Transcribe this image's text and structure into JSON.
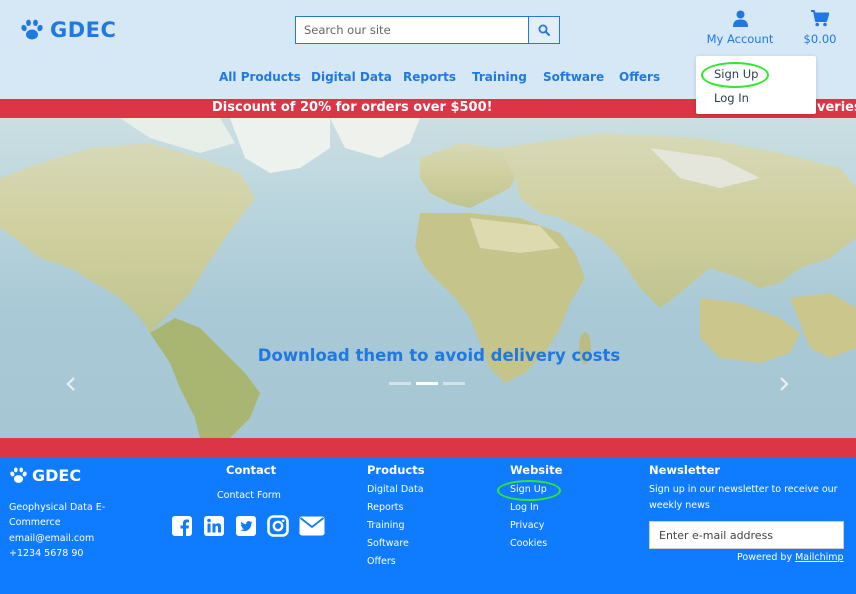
{
  "header": {
    "logo_text": "GDEC",
    "search_placeholder": "Search our site",
    "account_label": "My Account",
    "cart_label": "$0.00"
  },
  "nav": {
    "items": [
      "All Products",
      "Digital Data",
      "Reports",
      "Training",
      "Software",
      "Offers"
    ]
  },
  "account_menu": {
    "items": [
      "Sign Up",
      "Log In"
    ]
  },
  "promo": {
    "text": "Discount of 20% for orders over $500!",
    "text_next": "veries"
  },
  "hero": {
    "caption": "Download them to avoid delivery costs",
    "slide_count": 3,
    "active_slide": 2
  },
  "footer": {
    "logo_text": "GDEC",
    "company_line1": "Geophysical Data E-",
    "company_line2": "Commerce",
    "email": "email@email.com",
    "phone": "+1234 5678 90",
    "contact": {
      "heading": "Contact",
      "link": "Contact Form"
    },
    "products": {
      "heading": "Products",
      "links": [
        "Digital Data",
        "Reports",
        "Training",
        "Software",
        "Offers"
      ]
    },
    "website": {
      "heading": "Website",
      "links": [
        "Sign Up",
        "Log In",
        "Privacy",
        "Cookies"
      ]
    },
    "newsletter": {
      "heading": "Newsletter",
      "text_line1": "Sign up in our newsletter to receive our",
      "text_line2": "weekly news",
      "input_placeholder": "Enter e-mail address",
      "powered_prefix": "Powered by ",
      "powered_link": "Mailchimp"
    },
    "socials": [
      "facebook-icon",
      "linkedin-icon",
      "twitter-icon",
      "instagram-icon",
      "envelope-icon"
    ]
  },
  "colors": {
    "brand_blue": "#1f79e0",
    "header_bg": "#d6e8f5",
    "promo_red": "#dc3545",
    "footer_blue": "#0f7bff",
    "highlight_green": "#2ee82e"
  }
}
